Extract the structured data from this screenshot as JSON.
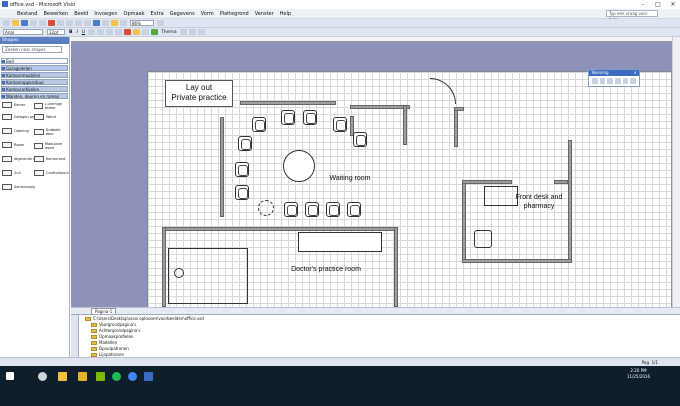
{
  "window": {
    "title": "office.vsd - Microsoft Visio",
    "help_placeholder": "Typ een vraag voor hulp"
  },
  "menu": [
    "Bestand",
    "Bewerken",
    "Beeld",
    "Invoegen",
    "Opmaak",
    "Extra",
    "Gegevens",
    "Vorm",
    "Plattegrond",
    "Venster",
    "Help"
  ],
  "toolbar": {
    "font_name": "Arial",
    "font_size": "12pt",
    "zoom": "86%",
    "thema_label": "Thema"
  },
  "shapes_panel": {
    "title": "Shapes",
    "search_placeholder": "Zoeken naar shapes",
    "stencils": [
      "Bed",
      "Garagedelen",
      "Kantoormeubilair",
      "Kantoorapparatuur",
      "Kantoorartikelen",
      "Wanden, deuren en ramen"
    ],
    "masters": [
      "Kamer",
      "L-vormige kamer",
      "Gelegen wand",
      "Wand",
      "Opening",
      "Dubbele deur",
      "Raam",
      "Modulaire wand",
      "Afgeronde muur",
      "Kamerrand",
      "Zuil",
      "Controlepunt",
      "Samenvoeg"
    ]
  },
  "drawing": {
    "title_line1": "Lay out",
    "title_line2": "Private practice",
    "room_waiting": "Waiting room",
    "room_doctor": "Doctor's practice room",
    "room_front_l1": "Front desk and",
    "room_front_l2": "pharmacy"
  },
  "toolbox": {
    "title": "Tekening"
  },
  "tabs": {
    "page1": "Pagina-1"
  },
  "explorer": {
    "root": "C:\\Users\\Desktop\\visio oplossen\\voorbeelden\\office.vsd",
    "items": [
      "Voorgrondpagina's",
      "Achtergrondpagina's",
      "Opmaakprofielen",
      "Modellen",
      "Opvulpatronen",
      "Lijnpatronen"
    ]
  },
  "status": {
    "page": "Pag. 1/1"
  },
  "clock": {
    "time": "2:20 PM",
    "date": "11/25/2016"
  }
}
